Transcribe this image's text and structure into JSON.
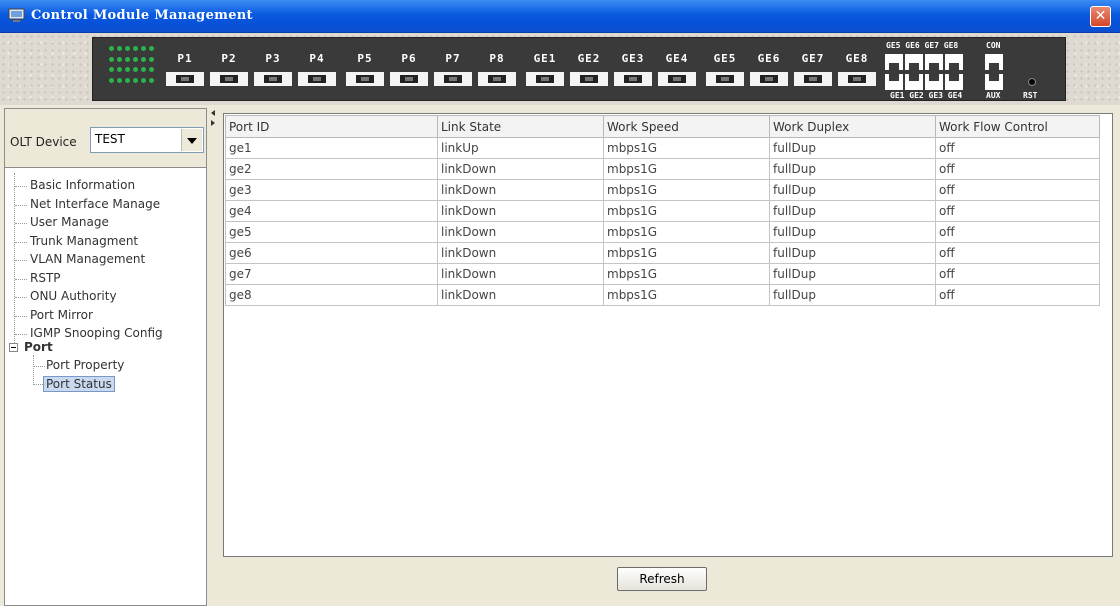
{
  "window": {
    "title": "Control Module Management",
    "close_label": "✕"
  },
  "device": {
    "port_labels": [
      "P1",
      "P2",
      "P3",
      "P4",
      "P5",
      "P6",
      "P7",
      "P8",
      "GE1",
      "GE2",
      "GE3",
      "GE4",
      "GE5",
      "GE6",
      "GE7",
      "GE8"
    ],
    "rj_top_labels": "GE5 GE6 GE7 GE8",
    "rj_bottom_labels": "GE1 GE2 GE3 GE4",
    "con_label": "CON",
    "aux_label": "AUX",
    "rst_label": "RST",
    "led_color": "#2db34b"
  },
  "sidebar": {
    "olt_label": "OLT Device",
    "olt_value": "TEST",
    "tree": [
      "Basic Information",
      "Net Interface Manage",
      "User Manage",
      "Trunk Managment",
      "VLAN Management",
      "RSTP",
      "ONU Authority",
      "Port Mirror",
      "IGMP Snooping Config"
    ],
    "port_node": "Port",
    "port_children": [
      "Port Property",
      "Port Status"
    ]
  },
  "table": {
    "headers": [
      "Port ID",
      "Link State",
      "Work Speed",
      "Work Duplex",
      "Work Flow Control"
    ],
    "rows": [
      [
        "ge1",
        "linkUp",
        "mbps1G",
        "fullDup",
        "off"
      ],
      [
        "ge2",
        "linkDown",
        "mbps1G",
        "fullDup",
        "off"
      ],
      [
        "ge3",
        "linkDown",
        "mbps1G",
        "fullDup",
        "off"
      ],
      [
        "ge4",
        "linkDown",
        "mbps1G",
        "fullDup",
        "off"
      ],
      [
        "ge5",
        "linkDown",
        "mbps1G",
        "fullDup",
        "off"
      ],
      [
        "ge6",
        "linkDown",
        "mbps1G",
        "fullDup",
        "off"
      ],
      [
        "ge7",
        "linkDown",
        "mbps1G",
        "fullDup",
        "off"
      ],
      [
        "ge8",
        "linkDown",
        "mbps1G",
        "fullDup",
        "off"
      ]
    ]
  },
  "refresh_label": "Refresh"
}
